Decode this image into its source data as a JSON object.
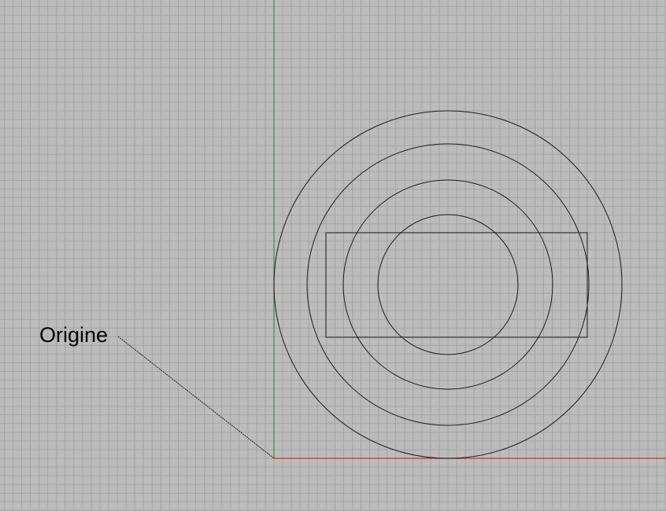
{
  "viewport": {
    "background_color": "#bcbcbc",
    "grid_color": "#a4a4a4",
    "x_axis_color": "#c8322a",
    "y_axis_color": "#2f9a2f",
    "curve_color": "#1c1c1c"
  },
  "annotation": {
    "label": "Origine",
    "leader_style": "dashed"
  }
}
